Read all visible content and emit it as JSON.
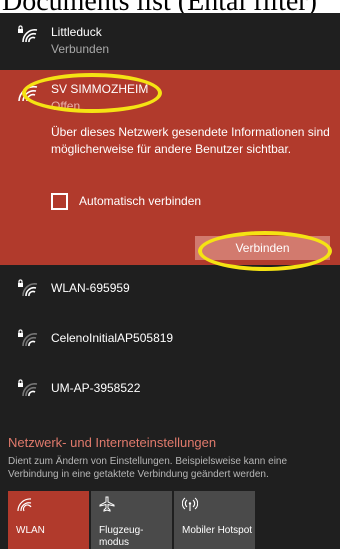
{
  "document": {
    "caption": "Documents list (Ental filter)"
  },
  "networks": {
    "top": {
      "name": "Littleduck",
      "status": "Verbunden"
    },
    "selected": {
      "name": "SV SIMMOZHEIM",
      "status": "Offen",
      "description": "Über dieses Netzwerk gesendete Informationen sind möglicherweise für andere Benutzer sichtbar.",
      "auto_connect_label": "Automatisch verbinden",
      "auto_connect_checked": false,
      "connect_label": "Verbinden"
    },
    "others": [
      {
        "name": "WLAN-695959"
      },
      {
        "name": "CelenoInitialAP505819"
      },
      {
        "name": "UM-AP-3958522"
      }
    ]
  },
  "settings": {
    "title": "Netzwerk- und Interneteinstellungen",
    "description": "Dient zum Ändern von Einstellungen. Beispielsweise kann eine Verbindung in eine getaktete Verbindung geändert werden."
  },
  "quick_actions": [
    {
      "label": "WLAN",
      "icon": "wifi-icon",
      "active": true
    },
    {
      "label": "Flugzeug-modus",
      "icon": "airplane-icon",
      "active": false
    },
    {
      "label": "Mobiler Hotspot",
      "icon": "hotspot-icon",
      "active": false
    }
  ],
  "colors": {
    "flyout_bg": "#1f1f1f",
    "accent": "#b13a2c",
    "accent_button": "#d27a6e",
    "settings_link": "#e07a6c",
    "annotation": "#f5e313"
  }
}
